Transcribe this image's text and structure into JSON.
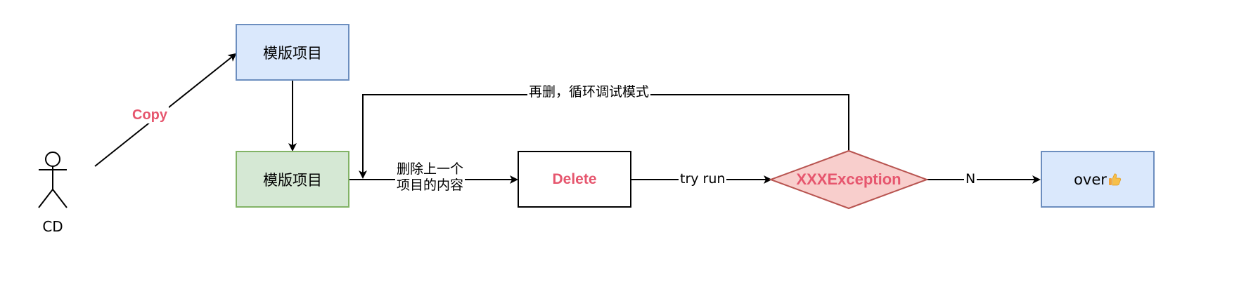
{
  "actor": {
    "label": "CD"
  },
  "nodes": {
    "template_top": {
      "label": "模版项目",
      "fill": "#dae8fc",
      "stroke": "#6c8ebf"
    },
    "template_main": {
      "label": "模版项目",
      "fill": "#d5e8d4",
      "stroke": "#82b366"
    },
    "delete": {
      "label": "Delete",
      "fill": "#ffffff",
      "stroke": "#000000",
      "text_color": "#e6566e"
    },
    "exception": {
      "label": "XXXException",
      "fill": "#f8cecc",
      "stroke": "#b85450",
      "text_color": "#e6566e"
    },
    "over": {
      "label": "over",
      "icon": "thumbs-up-icon",
      "fill": "#dae8fc",
      "stroke": "#6c8ebf"
    }
  },
  "edges": {
    "copy": {
      "label": "Copy",
      "text_color": "#e6566e"
    },
    "delete_prev": {
      "label_line1": "删除上一个",
      "label_line2": "项目的内容"
    },
    "try_run": {
      "label": "try run"
    },
    "no": {
      "label": "N"
    },
    "loop": {
      "label": "再删，循环调试模式"
    }
  }
}
